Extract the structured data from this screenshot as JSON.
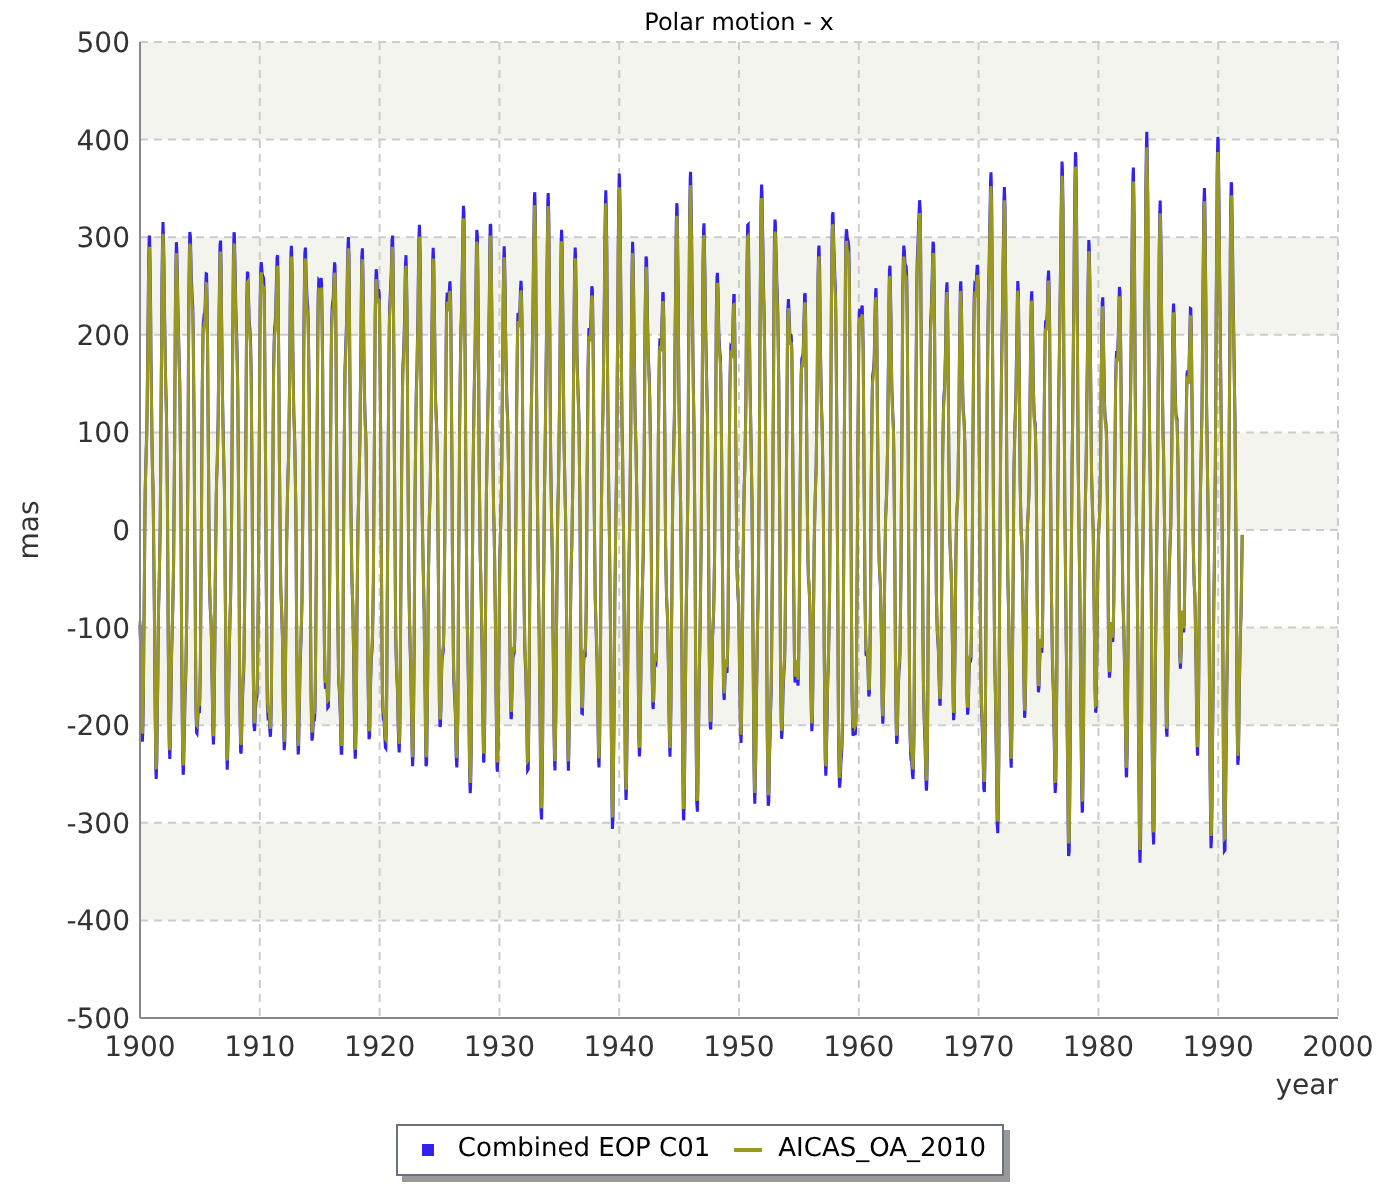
{
  "chart": {
    "title": "Polar motion - x",
    "ylabel": "mas",
    "xlabel": "year",
    "yticks": [
      "500",
      "400",
      "300",
      "200",
      "100",
      "0",
      "-100",
      "-200",
      "-300",
      "-400",
      "-500"
    ],
    "xticks": [
      "1900",
      "1910",
      "1920",
      "1930",
      "1940",
      "1950",
      "1960",
      "1970",
      "1980",
      "1990",
      "2000"
    ]
  },
  "legend": [
    {
      "label": "Combined EOP C01",
      "color": "#3322ee",
      "kind": "bar"
    },
    {
      "label": "AICAS_OA_2010",
      "color": "#999922",
      "kind": "line"
    }
  ]
}
